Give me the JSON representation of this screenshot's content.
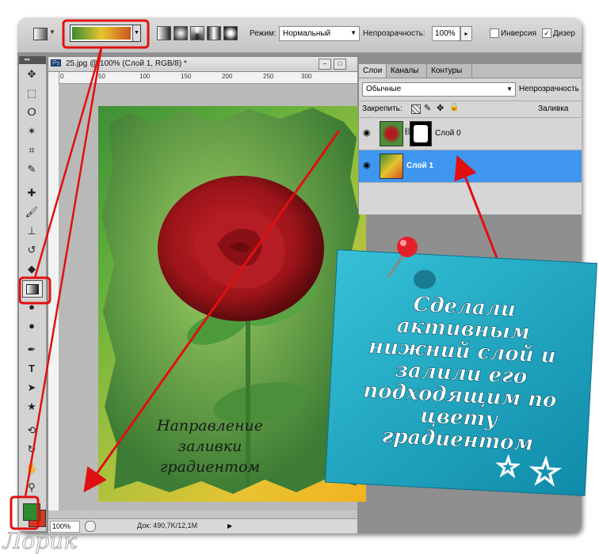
{
  "options_bar": {
    "mode_label": "Режим:",
    "mode_value": "Нормальный",
    "opacity_label": "Непрозрачность:",
    "opacity_value": "100%",
    "inversion_label": "Инверсия",
    "dither_label": "Дизер"
  },
  "document": {
    "tab_title": "25.jpg @ 100% (Слой 1, RGB/8) *",
    "ps_badge": "Ps",
    "ruler_numbers": [
      "0",
      "50",
      "100",
      "150",
      "200",
      "250",
      "300"
    ],
    "zoom": "100%",
    "status": "Док: 490,7K/12,1M"
  },
  "layers_panel": {
    "tabs": [
      "Слои",
      "Каналы",
      "Контуры"
    ],
    "blend_mode": "Обычные",
    "opacity_label": "Непрозрачность",
    "lock_label": "Закрепить:",
    "fill_label": "Заливка",
    "layers": [
      {
        "name": "Слой 0",
        "active": false
      },
      {
        "name": "Слой 1",
        "active": true
      }
    ]
  },
  "annotations": {
    "direction_note": [
      "Направление",
      "заливки",
      "градиентом"
    ],
    "sticky_note": [
      "Сделали",
      "активным",
      "нижний слой и",
      "залили его",
      "подходящим по",
      "цвету",
      "градиентом"
    ]
  },
  "colors": {
    "foreground": "#2e8b2e",
    "background": "#d13a20",
    "highlight": "#e01010",
    "layer_selected": "#3f96f0"
  },
  "watermark": "Лорик"
}
